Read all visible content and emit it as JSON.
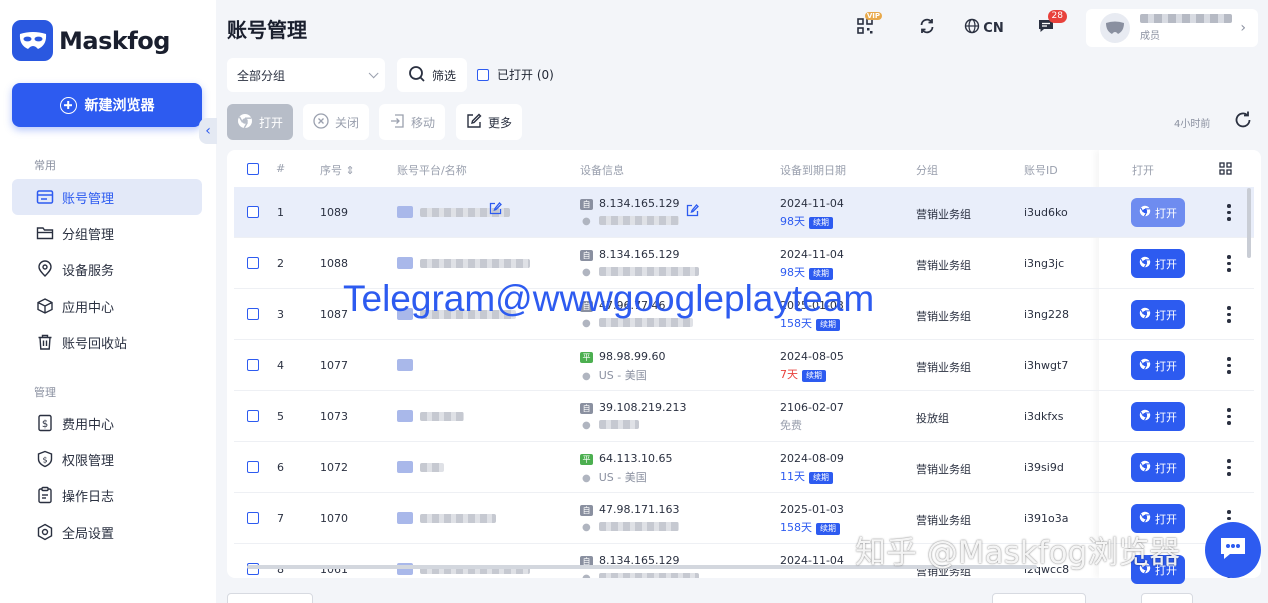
{
  "brand": {
    "name": "Maskfog",
    "accent": "#2d5bf0"
  },
  "sidebar": {
    "new_button": "新建浏览器",
    "sections": [
      {
        "label": "常用",
        "items": [
          {
            "label": "账号管理",
            "icon": "account-card-icon",
            "active": true
          },
          {
            "label": "分组管理",
            "icon": "folder-icon"
          },
          {
            "label": "设备服务",
            "icon": "location-pin-icon"
          },
          {
            "label": "应用中心",
            "icon": "cube-icon"
          },
          {
            "label": "账号回收站",
            "icon": "trash-icon"
          }
        ]
      },
      {
        "label": "管理",
        "items": [
          {
            "label": "费用中心",
            "icon": "dollar-doc-icon"
          },
          {
            "label": "权限管理",
            "icon": "shield-dollar-icon"
          },
          {
            "label": "操作日志",
            "icon": "clipboard-icon"
          },
          {
            "label": "全局设置",
            "icon": "hexagon-gear-icon"
          }
        ]
      }
    ]
  },
  "header": {
    "title": "账号管理",
    "vip_badge": "VIP",
    "language": "CN",
    "message_count": "28",
    "user_role": "成员"
  },
  "filters": {
    "group_select": "全部分组",
    "filter_button": "筛选",
    "opened_checkbox": "已打开 (0)"
  },
  "toolbar": {
    "open": "打开",
    "close": "关闭",
    "move": "移动",
    "more": "更多",
    "refresh_time": "4小时前"
  },
  "table": {
    "columns": [
      "#",
      "序号",
      "账号平台/名称",
      "设备信息",
      "设备到期日期",
      "分组",
      "账号ID",
      "打开"
    ],
    "open_label": "打开",
    "renew_label": "续期",
    "rows": [
      {
        "n": "1",
        "serial": "1089",
        "device_type": "自",
        "ip": "8.134.165.129",
        "loc": "",
        "date": "2024-11-04",
        "days": "98天",
        "renew": true,
        "group": "营销业务组",
        "id": "i3ud6ko"
      },
      {
        "n": "2",
        "serial": "1088",
        "device_type": "自",
        "ip": "8.134.165.129",
        "loc": "",
        "date": "2024-11-04",
        "days": "98天",
        "renew": true,
        "group": "营销业务组",
        "id": "i3ng3jc"
      },
      {
        "n": "3",
        "serial": "1087",
        "device_type": "自",
        "ip": "47.96.77.46",
        "loc": "",
        "date": "2025-01-03",
        "days": "158天",
        "renew": true,
        "group": "营销业务组",
        "id": "i3ng228"
      },
      {
        "n": "4",
        "serial": "1077",
        "device_type": "平",
        "ip": "98.98.99.60",
        "loc": "US - 美国",
        "date": "2024-08-05",
        "days": "7天",
        "days_warn": true,
        "renew": true,
        "group": "营销业务组",
        "id": "i3hwgt7"
      },
      {
        "n": "5",
        "serial": "1073",
        "device_type": "自",
        "ip": "39.108.219.213",
        "loc": "",
        "date": "2106-02-07",
        "days": "免费",
        "days_free": true,
        "renew": false,
        "group": "投放组",
        "id": "i3dkfxs"
      },
      {
        "n": "6",
        "serial": "1072",
        "device_type": "平",
        "ip": "64.113.10.65",
        "loc": "US - 美国",
        "date": "2024-08-09",
        "days": "11天",
        "renew": true,
        "group": "营销业务组",
        "id": "i39si9d"
      },
      {
        "n": "7",
        "serial": "1070",
        "device_type": "自",
        "ip": "47.98.171.163",
        "loc": "",
        "date": "2025-01-03",
        "days": "158天",
        "renew": true,
        "group": "营销业务组",
        "id": "i391o3a"
      },
      {
        "n": "8",
        "serial": "1061",
        "device_type": "自",
        "ip": "8.134.165.129",
        "loc": "",
        "date": "2024-11-04",
        "days": "",
        "renew": false,
        "group": "营销业务组",
        "id": "i2qwcc8"
      }
    ]
  },
  "overlays": {
    "watermark": "Telegram@wwwgoogleplayteam",
    "zhihu": "知乎 @Maskfog浏览器"
  }
}
